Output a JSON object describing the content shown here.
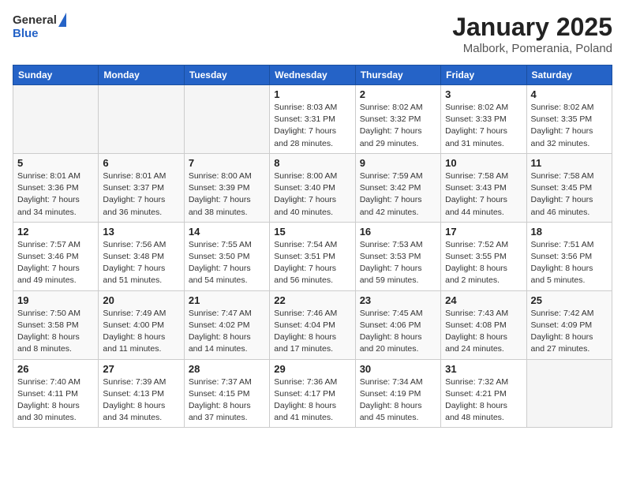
{
  "header": {
    "logo_general": "General",
    "logo_blue": "Blue",
    "title": "January 2025",
    "subtitle": "Malbork, Pomerania, Poland"
  },
  "days_of_week": [
    "Sunday",
    "Monday",
    "Tuesday",
    "Wednesday",
    "Thursday",
    "Friday",
    "Saturday"
  ],
  "weeks": [
    [
      {
        "day": "",
        "info": ""
      },
      {
        "day": "",
        "info": ""
      },
      {
        "day": "",
        "info": ""
      },
      {
        "day": "1",
        "info": "Sunrise: 8:03 AM\nSunset: 3:31 PM\nDaylight: 7 hours\nand 28 minutes."
      },
      {
        "day": "2",
        "info": "Sunrise: 8:02 AM\nSunset: 3:32 PM\nDaylight: 7 hours\nand 29 minutes."
      },
      {
        "day": "3",
        "info": "Sunrise: 8:02 AM\nSunset: 3:33 PM\nDaylight: 7 hours\nand 31 minutes."
      },
      {
        "day": "4",
        "info": "Sunrise: 8:02 AM\nSunset: 3:35 PM\nDaylight: 7 hours\nand 32 minutes."
      }
    ],
    [
      {
        "day": "5",
        "info": "Sunrise: 8:01 AM\nSunset: 3:36 PM\nDaylight: 7 hours\nand 34 minutes."
      },
      {
        "day": "6",
        "info": "Sunrise: 8:01 AM\nSunset: 3:37 PM\nDaylight: 7 hours\nand 36 minutes."
      },
      {
        "day": "7",
        "info": "Sunrise: 8:00 AM\nSunset: 3:39 PM\nDaylight: 7 hours\nand 38 minutes."
      },
      {
        "day": "8",
        "info": "Sunrise: 8:00 AM\nSunset: 3:40 PM\nDaylight: 7 hours\nand 40 minutes."
      },
      {
        "day": "9",
        "info": "Sunrise: 7:59 AM\nSunset: 3:42 PM\nDaylight: 7 hours\nand 42 minutes."
      },
      {
        "day": "10",
        "info": "Sunrise: 7:58 AM\nSunset: 3:43 PM\nDaylight: 7 hours\nand 44 minutes."
      },
      {
        "day": "11",
        "info": "Sunrise: 7:58 AM\nSunset: 3:45 PM\nDaylight: 7 hours\nand 46 minutes."
      }
    ],
    [
      {
        "day": "12",
        "info": "Sunrise: 7:57 AM\nSunset: 3:46 PM\nDaylight: 7 hours\nand 49 minutes."
      },
      {
        "day": "13",
        "info": "Sunrise: 7:56 AM\nSunset: 3:48 PM\nDaylight: 7 hours\nand 51 minutes."
      },
      {
        "day": "14",
        "info": "Sunrise: 7:55 AM\nSunset: 3:50 PM\nDaylight: 7 hours\nand 54 minutes."
      },
      {
        "day": "15",
        "info": "Sunrise: 7:54 AM\nSunset: 3:51 PM\nDaylight: 7 hours\nand 56 minutes."
      },
      {
        "day": "16",
        "info": "Sunrise: 7:53 AM\nSunset: 3:53 PM\nDaylight: 7 hours\nand 59 minutes."
      },
      {
        "day": "17",
        "info": "Sunrise: 7:52 AM\nSunset: 3:55 PM\nDaylight: 8 hours\nand 2 minutes."
      },
      {
        "day": "18",
        "info": "Sunrise: 7:51 AM\nSunset: 3:56 PM\nDaylight: 8 hours\nand 5 minutes."
      }
    ],
    [
      {
        "day": "19",
        "info": "Sunrise: 7:50 AM\nSunset: 3:58 PM\nDaylight: 8 hours\nand 8 minutes."
      },
      {
        "day": "20",
        "info": "Sunrise: 7:49 AM\nSunset: 4:00 PM\nDaylight: 8 hours\nand 11 minutes."
      },
      {
        "day": "21",
        "info": "Sunrise: 7:47 AM\nSunset: 4:02 PM\nDaylight: 8 hours\nand 14 minutes."
      },
      {
        "day": "22",
        "info": "Sunrise: 7:46 AM\nSunset: 4:04 PM\nDaylight: 8 hours\nand 17 minutes."
      },
      {
        "day": "23",
        "info": "Sunrise: 7:45 AM\nSunset: 4:06 PM\nDaylight: 8 hours\nand 20 minutes."
      },
      {
        "day": "24",
        "info": "Sunrise: 7:43 AM\nSunset: 4:08 PM\nDaylight: 8 hours\nand 24 minutes."
      },
      {
        "day": "25",
        "info": "Sunrise: 7:42 AM\nSunset: 4:09 PM\nDaylight: 8 hours\nand 27 minutes."
      }
    ],
    [
      {
        "day": "26",
        "info": "Sunrise: 7:40 AM\nSunset: 4:11 PM\nDaylight: 8 hours\nand 30 minutes."
      },
      {
        "day": "27",
        "info": "Sunrise: 7:39 AM\nSunset: 4:13 PM\nDaylight: 8 hours\nand 34 minutes."
      },
      {
        "day": "28",
        "info": "Sunrise: 7:37 AM\nSunset: 4:15 PM\nDaylight: 8 hours\nand 37 minutes."
      },
      {
        "day": "29",
        "info": "Sunrise: 7:36 AM\nSunset: 4:17 PM\nDaylight: 8 hours\nand 41 minutes."
      },
      {
        "day": "30",
        "info": "Sunrise: 7:34 AM\nSunset: 4:19 PM\nDaylight: 8 hours\nand 45 minutes."
      },
      {
        "day": "31",
        "info": "Sunrise: 7:32 AM\nSunset: 4:21 PM\nDaylight: 8 hours\nand 48 minutes."
      },
      {
        "day": "",
        "info": ""
      }
    ]
  ]
}
